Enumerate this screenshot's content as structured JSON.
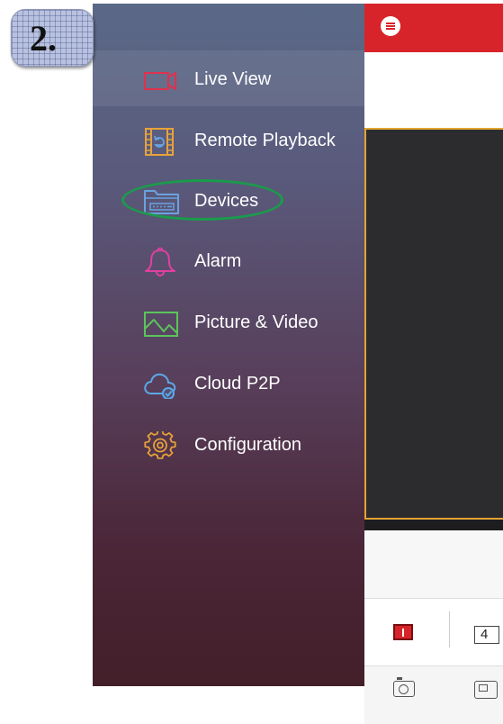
{
  "badge": {
    "text": "2."
  },
  "drawer": {
    "items": [
      {
        "label": "Live View",
        "icon": "video-camera-icon"
      },
      {
        "label": "Remote Playback",
        "icon": "film-playback-icon"
      },
      {
        "label": "Devices",
        "icon": "device-folder-icon"
      },
      {
        "label": "Alarm",
        "icon": "bell-icon"
      },
      {
        "label": "Picture & Video",
        "icon": "picture-icon"
      },
      {
        "label": "Cloud P2P",
        "icon": "cloud-check-icon"
      },
      {
        "label": "Configuration",
        "icon": "gear-icon"
      }
    ],
    "active_item": "Live View",
    "highlighted_item": "Devices"
  },
  "app": {
    "header_color": "#d7242a",
    "toolbar": {
      "split_four_label": "4"
    }
  },
  "colors": {
    "accent_red": "#d7242a",
    "highlight_green": "#1b9b4b",
    "live_view_icon": "#e0314e",
    "remote_playback_icon": "#e8a23a",
    "devices_icon": "#6aa2e0",
    "alarm_icon": "#e040a0",
    "picture_icon": "#5cc45c",
    "cloud_icon": "#5aa8e8",
    "configuration_icon": "#e8a23a"
  }
}
